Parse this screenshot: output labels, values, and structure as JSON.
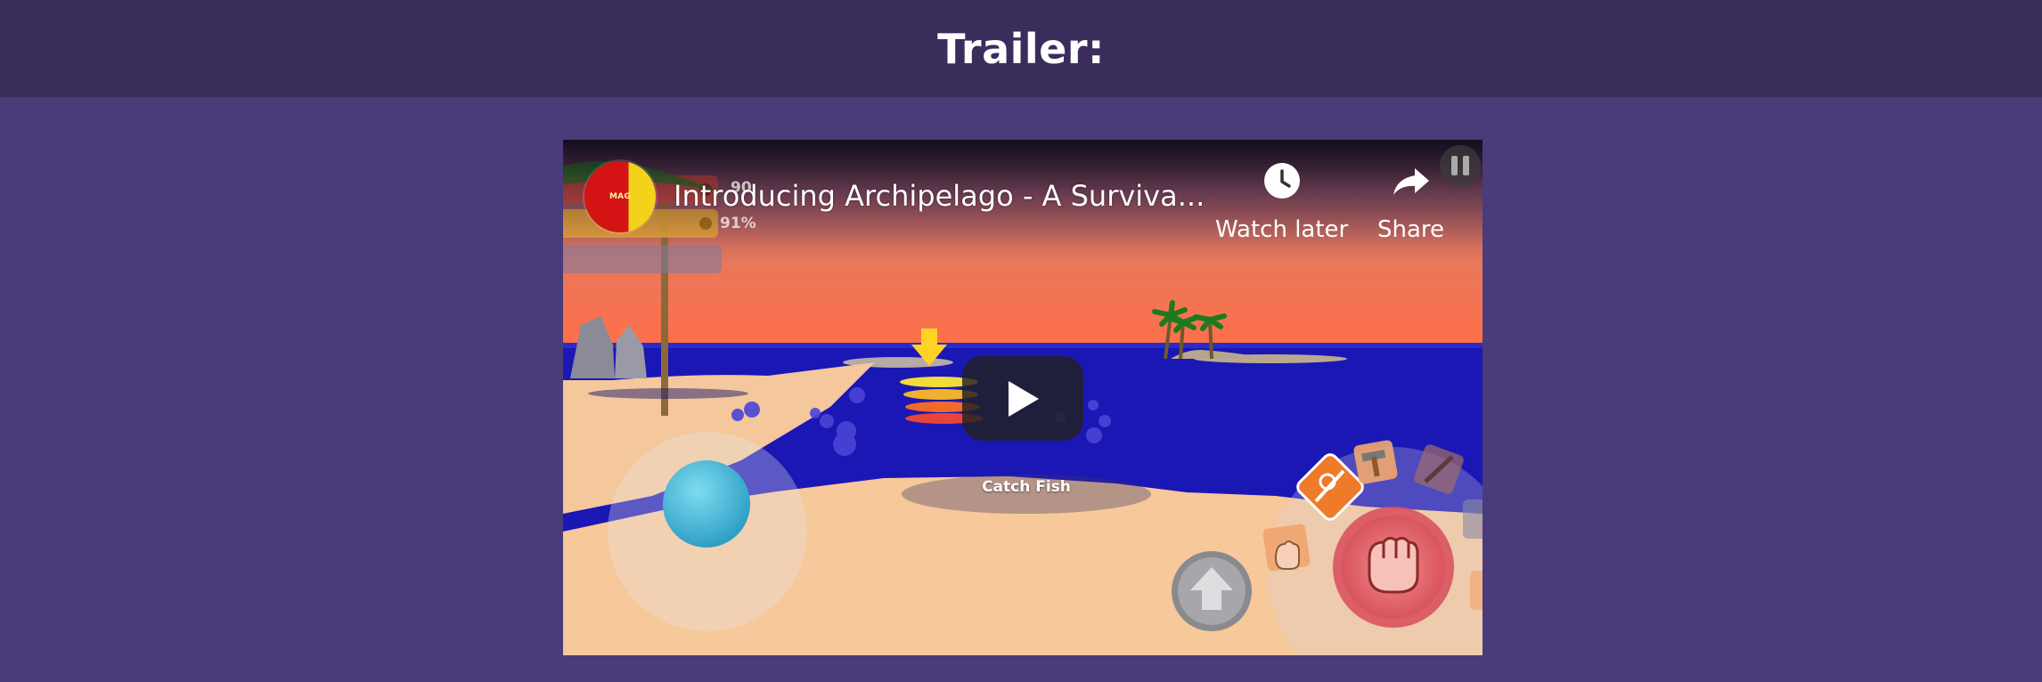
{
  "page": {
    "heading": "Trailer:"
  },
  "video": {
    "title": "Introducing Archipelago - A Surviva...",
    "channel_avatar_text": "MAG",
    "watch_later_label": "Watch later",
    "share_label": "Share",
    "icons": {
      "watch_later": "clock-icon",
      "share": "share-arrow-icon",
      "play": "play-icon"
    },
    "colors": {
      "play_button_bg": "#212121",
      "overlay_text": "#ffffff"
    }
  },
  "game_scene": {
    "hud_percent_top": "90",
    "hud_percent_bottom": "91%",
    "action_label": "Catch Fish",
    "icons": {
      "pause": "pause-icon",
      "jump": "up-arrow-icon",
      "punch": "fist-icon",
      "fishing": "fishing-rod-icon",
      "hammer": "hammer-icon",
      "tool": "tool-icon",
      "hand": "hand-icon",
      "joystick": "joystick-icon",
      "quest_marker": "down-arrow-icon",
      "palm_tree": "palm-tree-icon"
    }
  }
}
